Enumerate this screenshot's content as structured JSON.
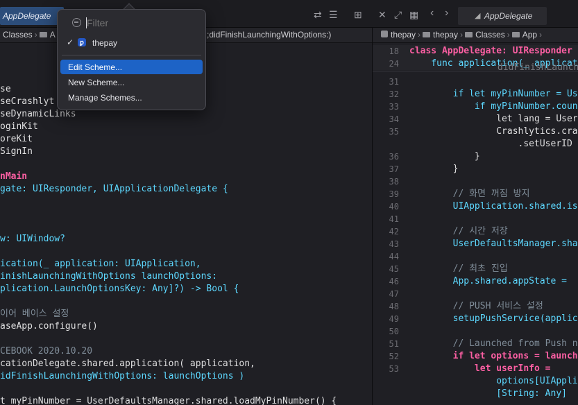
{
  "tabs": {
    "left_tab": "AppDelegate",
    "right_tab": "AppDelegate"
  },
  "breadcrumbs": {
    "left": [
      "Classes",
      "A",
      ";didFinishLaunchingWithOptions:)"
    ],
    "right": [
      "thepay",
      "thepay",
      "Classes",
      "App"
    ]
  },
  "scheme_popup": {
    "filter_placeholder": "Filter",
    "selected_scheme": "thepay",
    "menu_items": [
      "Edit Scheme...",
      "New Scheme...",
      "Manage Schemes..."
    ],
    "highlighted_item": "Edit Scheme..."
  },
  "left_editor": {
    "lines": [
      "se",
      "seCrashlyt",
      "seDynamicLinks",
      "oginKit",
      "oreKit",
      "SignIn",
      "",
      "nMain",
      "gate: UIResponder, UIApplicationDelegate {",
      "",
      "",
      "",
      "w: UIWindow?",
      "",
      "ication(_ application: UIApplication,",
      "inishLaunchingWithOptions launchOptions:",
      "plication.LaunchOptionsKey: Any]?) -> Bool {",
      "",
      "이어 베이스 설정",
      "aseApp.configure()",
      "",
      "CEBOOK 2020.10.20",
      "cationDelegate.shared.application( application,",
      "idFinishLaunchingWithOptions: launchOptions )",
      "",
      "t myPinNumber = UserDefaultsManager.shared.loadMyPinNumber() {"
    ]
  },
  "right_editor": {
    "sticky_lines": [
      {
        "num": "18",
        "code": "class AppDelegate: UIResponder"
      },
      {
        "num": "24",
        "code": "    func application(_ applicat"
      }
    ],
    "sticky_overflow": "didFinishLaunching",
    "lines": [
      {
        "num": "31",
        "code": ""
      },
      {
        "num": "32",
        "code": "        if let myPinNumber = Us"
      },
      {
        "num": "33",
        "code": "            if myPinNumber.coun"
      },
      {
        "num": "34",
        "code": "                let lang = User"
      },
      {
        "num": "35",
        "code": "                Crashlytics.cra"
      },
      {
        "num": "",
        "code": "                    .setUserID"
      },
      {
        "num": "36",
        "code": "            }"
      },
      {
        "num": "37",
        "code": "        }"
      },
      {
        "num": "38",
        "code": ""
      },
      {
        "num": "39",
        "code": "        // 화면 꺼짐 방지"
      },
      {
        "num": "40",
        "code": "        UIApplication.shared.is"
      },
      {
        "num": "41",
        "code": ""
      },
      {
        "num": "42",
        "code": "        // 시간 저장"
      },
      {
        "num": "43",
        "code": "        UserDefaultsManager.sha"
      },
      {
        "num": "44",
        "code": ""
      },
      {
        "num": "45",
        "code": "        // 최초 진입"
      },
      {
        "num": "46",
        "code": "        App.shared.appState = "
      },
      {
        "num": "47",
        "code": ""
      },
      {
        "num": "48",
        "code": "        // PUSH 서비스 설정"
      },
      {
        "num": "49",
        "code": "        setupPushService(applic"
      },
      {
        "num": "50",
        "code": ""
      },
      {
        "num": "51",
        "code": "        // Launched from Push n"
      },
      {
        "num": "52",
        "code": "        if let options = launch"
      },
      {
        "num": "53",
        "code": "            let userInfo ="
      },
      {
        "num": "",
        "code": "                options[UIAppli"
      },
      {
        "num": "",
        "code": "                [String: Any] "
      }
    ]
  }
}
